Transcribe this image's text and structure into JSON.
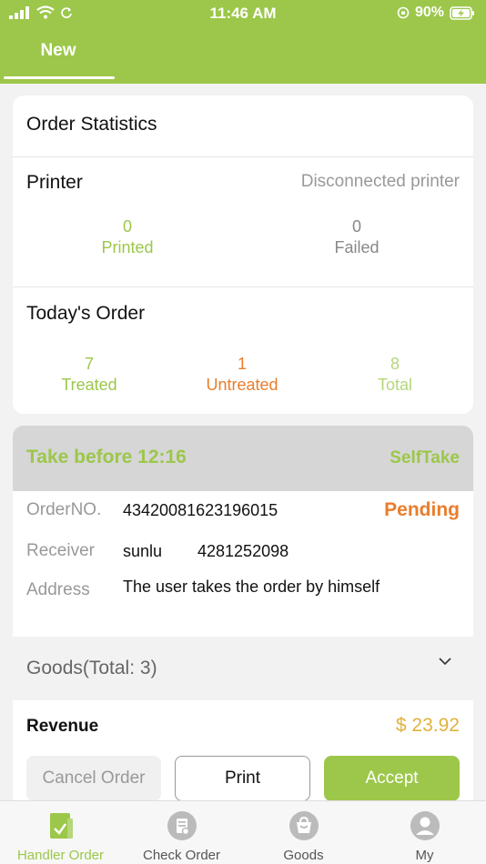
{
  "status_bar": {
    "time": "11:46 AM",
    "battery": "90%"
  },
  "tabs": {
    "active_label": "New"
  },
  "stats": {
    "title": "Order Statistics",
    "printer_label": "Printer",
    "printer_status": "Disconnected printer",
    "printed_count": "0",
    "printed_label": "Printed",
    "failed_count": "0",
    "failed_label": "Failed",
    "today_label": "Today's Order",
    "treated_count": "7",
    "treated_label": "Treated",
    "untreated_count": "1",
    "untreated_label": "Untreated",
    "total_count": "8",
    "total_label": "Total"
  },
  "order": {
    "take_before": "Take before 12:16",
    "type": "SelfTake",
    "order_no_label": "OrderNO.",
    "order_no": "43420081623196015",
    "status": "Pending",
    "receiver_label": "Receiver",
    "receiver_name": "sunlu",
    "receiver_phone": "4281252098",
    "address_label": "Address",
    "address": "The user takes the order by himself",
    "goods_label": "Goods(Total: 3)",
    "revenue_label": "Revenue",
    "revenue_value": "$ 23.92",
    "cancel_label": "Cancel Order",
    "print_label": "Print",
    "accept_label": "Accept"
  },
  "tabbar": {
    "items": [
      {
        "label": "Handler Order",
        "icon": "clipboard-check-icon"
      },
      {
        "label": "Check Order",
        "icon": "receipt-icon"
      },
      {
        "label": "Goods",
        "icon": "bag-icon"
      },
      {
        "label": "My",
        "icon": "user-icon"
      }
    ]
  },
  "colors": {
    "accent": "#9cc74a",
    "warning": "#ea7d2c",
    "price": "#e0b23e"
  }
}
